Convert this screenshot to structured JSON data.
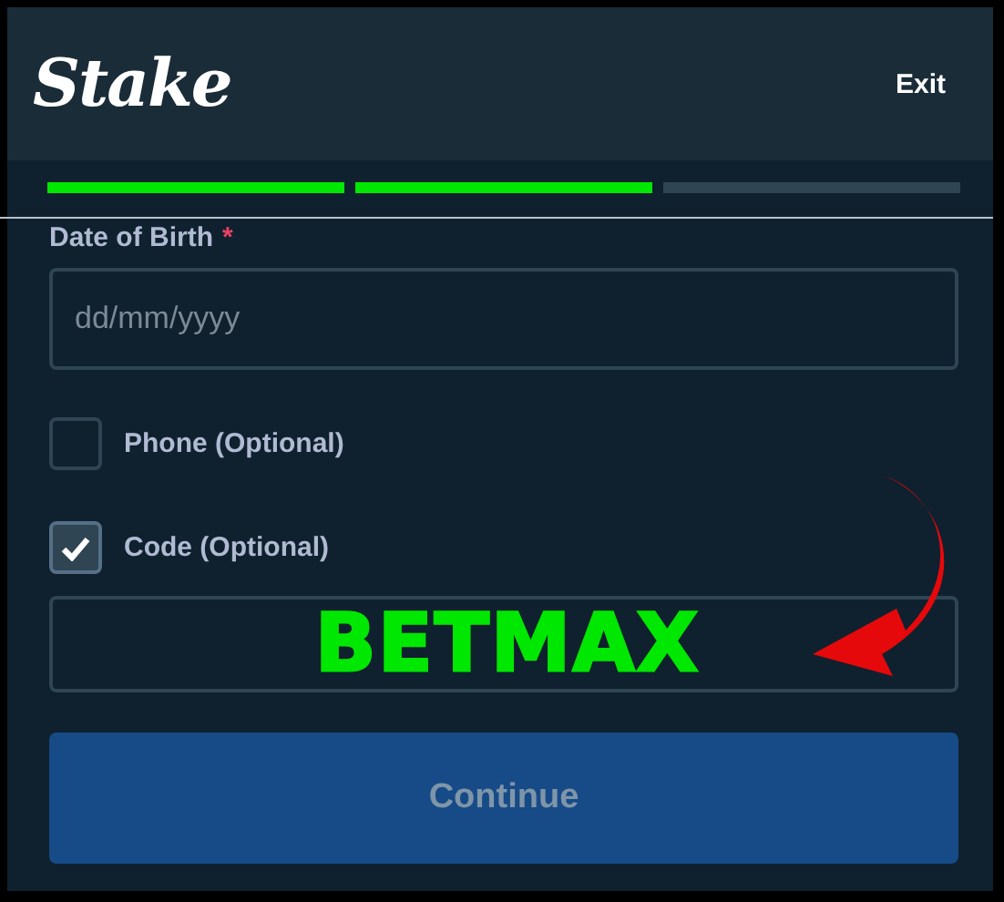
{
  "header": {
    "logo": "Stake",
    "exit_label": "Exit"
  },
  "progress_steps": [
    {
      "done": true
    },
    {
      "done": true
    },
    {
      "done": false
    }
  ],
  "date_of_birth": {
    "label": "Date of Birth",
    "required_mark": "*",
    "placeholder": "dd/mm/yyyy"
  },
  "options": [
    {
      "label": "Phone (Optional)",
      "checked": false
    },
    {
      "label": "Code (Optional)",
      "checked": true
    }
  ],
  "code_field": {
    "value": "BETMAX"
  },
  "continue_button": {
    "label": "Continue",
    "disabled": true
  }
}
